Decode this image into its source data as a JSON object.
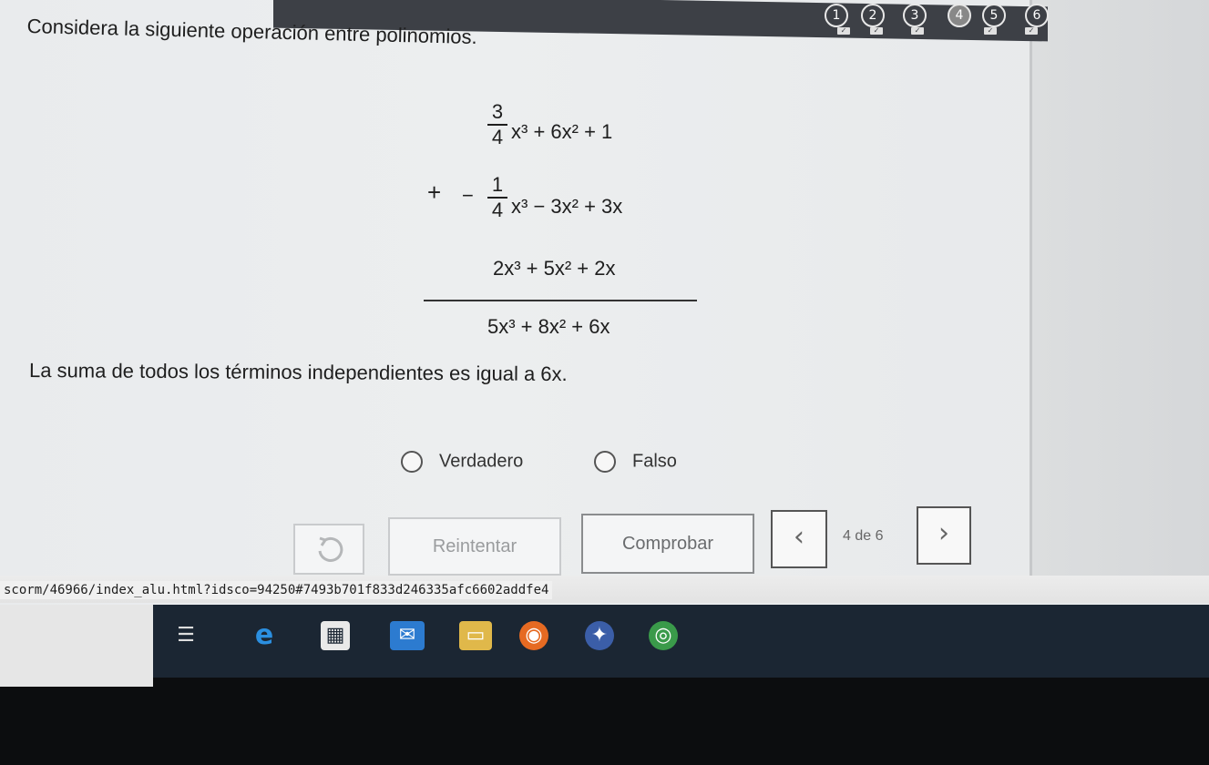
{
  "progress": {
    "steps": [
      {
        "label": "1",
        "status": "done"
      },
      {
        "label": "2",
        "status": "done"
      },
      {
        "label": "3",
        "status": "done"
      },
      {
        "label": "4",
        "status": "current"
      },
      {
        "label": "5",
        "status": "done"
      },
      {
        "label": "6",
        "status": "done"
      }
    ]
  },
  "question": {
    "prompt": "Considera la siguiente operación entre polinomios.",
    "poly": {
      "row1": {
        "num": "3",
        "den": "4",
        "rest": "x³  + 6x² + 1"
      },
      "row2": {
        "sign": "+",
        "prefix": "−",
        "num": "1",
        "den": "4",
        "rest": "x³  − 3x² + 3x"
      },
      "row3": "2x³  + 5x² + 2x",
      "result": "5x³  + 8x² + 6x"
    },
    "statement": "La suma de todos los términos independientes es igual a 6x."
  },
  "options": {
    "true_label": "Verdadero",
    "false_label": "Falso"
  },
  "buttons": {
    "retry": "Reintentar",
    "check": "Comprobar",
    "prev_icon": "chevron-left-icon",
    "next_icon": "chevron-right-icon",
    "page_indicator": "4 de 6"
  },
  "status_url": "scorm/46966/index_alu.html?idsco=94250#7493b701f833d246335afc6602addfe4",
  "taskbar": {
    "icons": [
      "task-view-icon",
      "edge-icon",
      "store-icon",
      "mail-icon",
      "explorer-icon",
      "firefox-icon",
      "app-icon",
      "chrome-icon"
    ]
  },
  "colors": {
    "accent": "#3d4046",
    "taskbar": "#1b2633"
  }
}
